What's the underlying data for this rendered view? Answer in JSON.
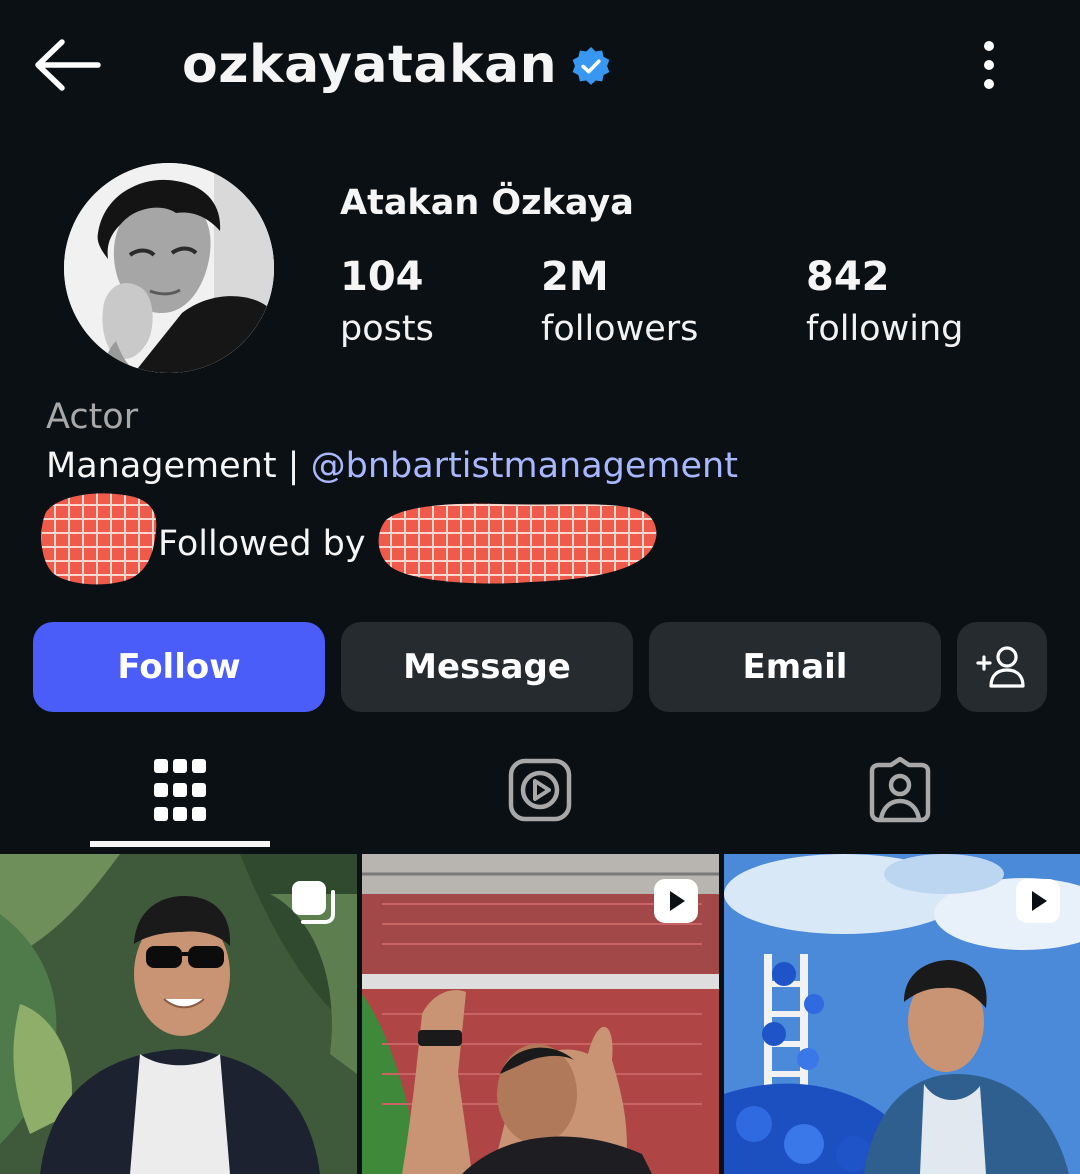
{
  "header": {
    "username": "ozkayatakan",
    "verified": true,
    "icons": [
      "back-arrow-icon",
      "verified-badge-icon",
      "more-vertical-icon"
    ]
  },
  "profile": {
    "full_name": "Atakan Özkaya",
    "stats": {
      "posts": {
        "value": "104",
        "label": "posts"
      },
      "followers": {
        "value": "2M",
        "label": "followers"
      },
      "following": {
        "value": "842",
        "label": "following"
      }
    },
    "category": "Actor",
    "bio_prefix": "Management | ",
    "bio_handle": "@bnbartistmanagement",
    "followed_by": "Followed by"
  },
  "actions": {
    "follow": "Follow",
    "message": "Message",
    "email": "Email",
    "add_user_icon": "add-person-icon"
  },
  "tabs": [
    {
      "name": "posts-grid",
      "icon": "grid-icon",
      "active": true
    },
    {
      "name": "reels",
      "icon": "reels-icon",
      "active": false
    },
    {
      "name": "tagged",
      "icon": "tagged-icon",
      "active": false
    }
  ],
  "posts": [
    {
      "type": "carousel",
      "badge_icon": "carousel-icon"
    },
    {
      "type": "reel",
      "badge_icon": "play-icon"
    },
    {
      "type": "reel",
      "badge_icon": "play-icon"
    }
  ],
  "colors": {
    "background": "#0b1014",
    "follow_button": "#4a5df9",
    "secondary_button": "#262b30",
    "link": "#a9b7ff",
    "verified_badge": "#3897f0",
    "muted_text": "#a8a8a8"
  }
}
